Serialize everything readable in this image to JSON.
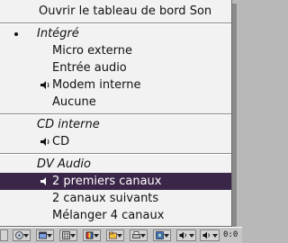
{
  "menu": {
    "open_panel": "Ouvrir le tableau de bord Son",
    "group_integrated": "Intégré",
    "items_integrated": [
      "Micro externe",
      "Entrée audio",
      "Modem interne",
      "Aucune"
    ],
    "group_cd": "CD interne",
    "items_cd": [
      "CD"
    ],
    "group_dv": "DV Audio",
    "items_dv": [
      "2 premiers canaux",
      "2 canaux suivants",
      "Mélanger 4 canaux"
    ],
    "selected_item": "2 premiers canaux"
  },
  "taskbar": {
    "clock": "0:0"
  },
  "colors": {
    "selection": "#3a2648",
    "menu_bg": "#f2f2f2",
    "taskbar_bg": "#c6c6c6"
  }
}
